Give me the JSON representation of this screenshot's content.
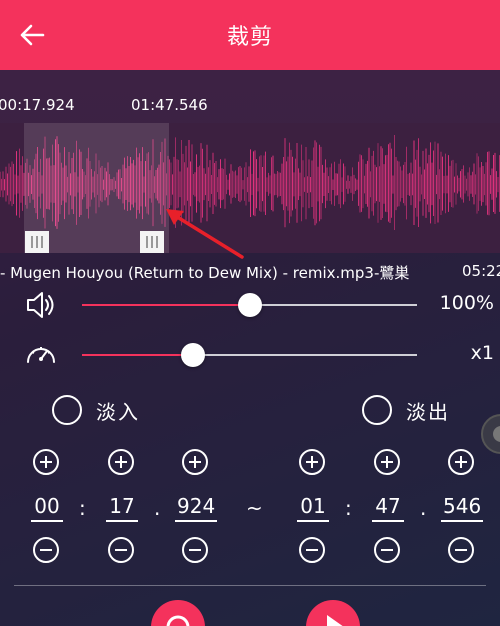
{
  "header": {
    "title": "裁剪",
    "back_icon": "arrow-left-icon"
  },
  "waveform": {
    "start_time": "00:17.924",
    "end_time": "01:47.546",
    "wave_color": "#e0337d"
  },
  "file": {
    "name": "- Mugen Houyou (Return to Dew Mix) - remix.mp3-鷺巣",
    "duration": "05:22"
  },
  "volume": {
    "icon": "speaker-icon",
    "value_label": "100%",
    "level": 0.5
  },
  "speed": {
    "icon": "speedometer-icon",
    "value_label": "x1",
    "level": 0.33
  },
  "fade": {
    "in_label": "淡入",
    "out_label": "淡出"
  },
  "start": {
    "min": "00",
    "sec": "17",
    "ms": "924"
  },
  "end": {
    "min": "01",
    "sec": "47",
    "ms": "546"
  },
  "separators": {
    "colon": ":",
    "dot": ".",
    "range": "~"
  },
  "colors": {
    "accent": "#f4325c"
  }
}
